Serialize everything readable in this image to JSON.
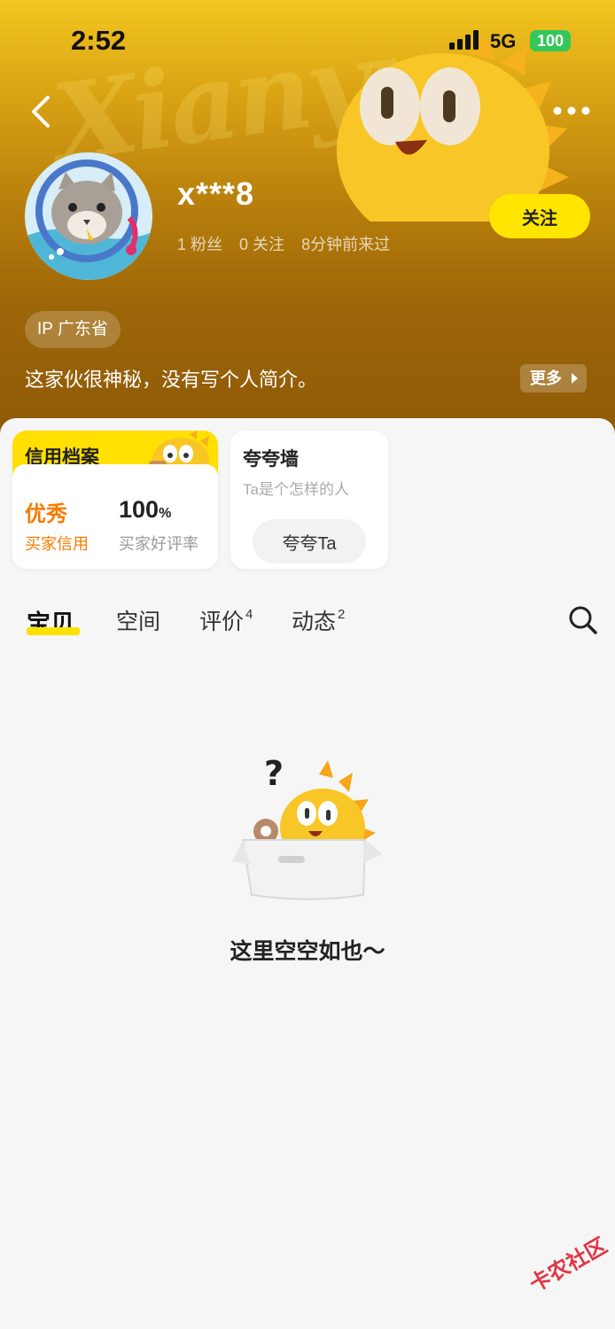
{
  "status_bar": {
    "time": "2:52",
    "network": "5G",
    "battery": "100"
  },
  "header": {
    "background_word": "Xianyu"
  },
  "profile": {
    "username": "x***8",
    "fans": "1 粉丝",
    "following": "0 关注",
    "last_seen": "8分钟前来过",
    "follow_label": "关注",
    "ip_location": "IP 广东省",
    "bio": "这家伙很神秘，没有写个人简介。",
    "more_label": "更多"
  },
  "credit": {
    "title": "信用档案",
    "grade": "优秀",
    "grade_label": "买家信用",
    "rate_value": "100",
    "rate_unit": "%",
    "rate_label": "买家好评率"
  },
  "praise": {
    "title": "夸夸墙",
    "subtitle": "Ta是个怎样的人",
    "button_label": "夸夸Ta"
  },
  "tabs": [
    {
      "label": "宝贝",
      "badge": ""
    },
    {
      "label": "空间",
      "badge": ""
    },
    {
      "label": "评价",
      "badge": "4"
    },
    {
      "label": "动态",
      "badge": "2"
    }
  ],
  "empty_state": {
    "text": "这里空空如也～"
  },
  "watermark": "卡农社区",
  "colors": {
    "accent": "#ffe000",
    "credit_orange": "#f57c00",
    "header_gold": "#d9a214"
  }
}
